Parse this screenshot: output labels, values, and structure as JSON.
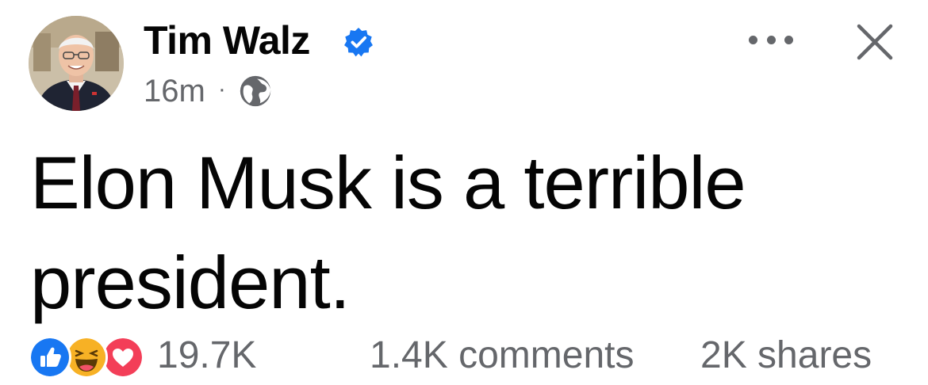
{
  "post": {
    "author": "Tim Walz",
    "verified": true,
    "timestamp": "16m",
    "separator": "·",
    "audience_icon": "globe-icon",
    "text": "Elon Musk is a terrible president.",
    "reactions": {
      "icons": [
        "like-icon",
        "haha-icon",
        "love-icon"
      ],
      "count": "19.7K"
    },
    "comments": "1.4K comments",
    "shares": "2K shares"
  },
  "colors": {
    "text": "#050505",
    "secondary": "#65676b",
    "verified_blue": "#1877f2",
    "like_blue": "#1877f2",
    "love_red": "#f33e58",
    "haha_yellow": "#f7b125"
  }
}
